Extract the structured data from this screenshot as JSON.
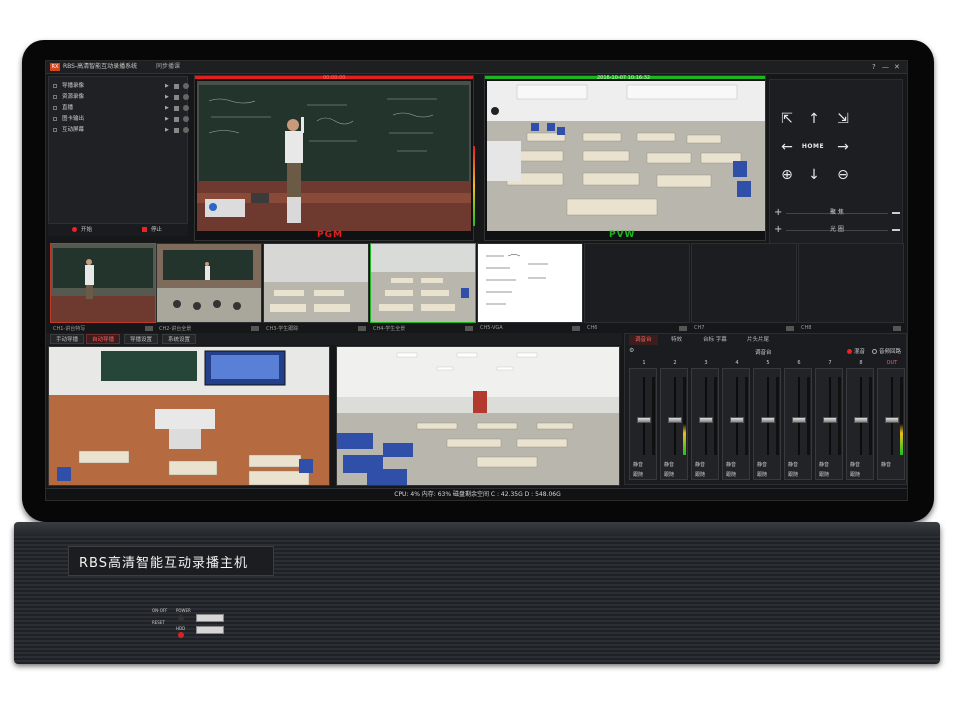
{
  "app": {
    "title": "RBS-高清智能互动录播系统",
    "mode": "同步播课",
    "window_controls": [
      "?",
      "—",
      "✕"
    ]
  },
  "controls": {
    "items": [
      {
        "label": "导播录像"
      },
      {
        "label": "资源录像"
      },
      {
        "label": "直播"
      },
      {
        "label": "图卡输出"
      },
      {
        "label": "互动屏幕"
      }
    ],
    "start_label": "开始",
    "stop_label": "停止"
  },
  "pgm": {
    "label": "PGM",
    "timestamp": "00:00:00"
  },
  "pvw": {
    "label": "PVW",
    "timestamp": "2016-10-07 10:16:32"
  },
  "ptz": {
    "home_label": "HOME",
    "focus_label": "聚 焦",
    "iris_label": "光 圈",
    "icons": [
      "walk-left-icon",
      "arrow-up-icon",
      "walk-right-icon",
      "arrow-left-icon",
      "home-icon",
      "arrow-right-icon",
      "zoom-in-icon",
      "arrow-down-icon",
      "zoom-out-icon"
    ]
  },
  "channels": [
    {
      "name": "CH1-讲台特写"
    },
    {
      "name": "CH2-讲台全景"
    },
    {
      "name": "CH3-学生跟踪"
    },
    {
      "name": "CH4-学生全景"
    },
    {
      "name": "CH5-VGA"
    },
    {
      "name": "CH6"
    },
    {
      "name": "CH7"
    },
    {
      "name": "CH8"
    }
  ],
  "tabs": [
    {
      "label": "手动导播"
    },
    {
      "label": "自动导播"
    },
    {
      "label": "导播设置"
    },
    {
      "label": "系统设置"
    }
  ],
  "mixer": {
    "tabs": [
      {
        "label": "调音台"
      },
      {
        "label": "特效"
      },
      {
        "label": "台标 字幕"
      },
      {
        "label": "片头片尾"
      }
    ],
    "title": "调音台",
    "mix_label": "混音",
    "passthrough_label": "音频回路",
    "mute_label": "静音",
    "follow_label": "跟随",
    "out_label": "OUT",
    "channels": [
      "1",
      "2",
      "3",
      "4",
      "5",
      "6",
      "7",
      "8"
    ],
    "fader_levels": [
      0.45,
      0.45,
      0.45,
      0.45,
      0.45,
      0.45,
      0.45,
      0.45,
      0.45
    ]
  },
  "status": {
    "text": "CPU:  4% 内存: 63% 磁盘剩余空间  C : 42.35G D : 548.06G"
  },
  "device": {
    "brand": "RBS高清智能互动录播主机",
    "onoff_label": "ON-OFF",
    "power_label": "POWER",
    "reset_label": "RESET",
    "hdd_label": "HDD"
  },
  "colors": {
    "pgm": "#e02020",
    "pvw": "#1fb520",
    "accent": "#ff5b5b"
  }
}
